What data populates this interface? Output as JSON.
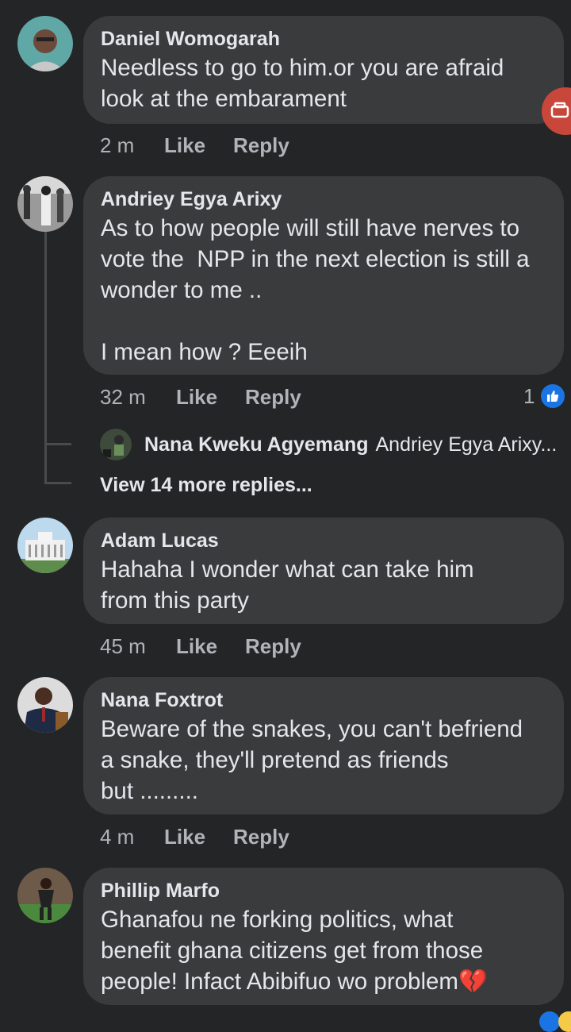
{
  "comments": [
    {
      "author": "Daniel Womogarah",
      "text": "Needless to go to him.or you are afraid\nlook at the embarament",
      "time": "2 m",
      "like": "Like",
      "reply": "Reply"
    },
    {
      "author": "Andriey Egya Arixy",
      "text": "As to how people will still have nerves to\nvote the  NPP in the next election is still a\nwonder to me ..\n\nI mean how ? Eeeih",
      "time": "32 m",
      "like": "Like",
      "reply": "Reply",
      "reaction_count": "1",
      "reply_preview": {
        "author": "Nana Kweku Agyemang",
        "snippet": "Andriey Egya Arixy..."
      },
      "view_more": "View 14 more replies..."
    },
    {
      "author": "Adam Lucas",
      "text": "Hahaha I wonder what can take him\nfrom this party",
      "time": "45 m",
      "like": "Like",
      "reply": "Reply"
    },
    {
      "author": "Nana Foxtrot",
      "text": "Beware of the snakes, you can't befriend\na snake, they'll pretend as friends\nbut .........",
      "time": "4 m",
      "like": "Like",
      "reply": "Reply"
    },
    {
      "author": "Phillip Marfo",
      "text": "Ghanafou ne forking politics, what\nbenefit ghana citizens get from those\npeople! Infact Abibifuo wo problem",
      "emoji": "💔"
    }
  ],
  "icons": {
    "like_badge": "thumbs-up-icon",
    "float_button": "chat-heads-icon",
    "broken_heart": "broken-heart-icon"
  },
  "colors": {
    "background": "#242526",
    "bubble": "#3a3b3c",
    "like_blue": "#1b74e4",
    "float_red": "#c9473a"
  }
}
